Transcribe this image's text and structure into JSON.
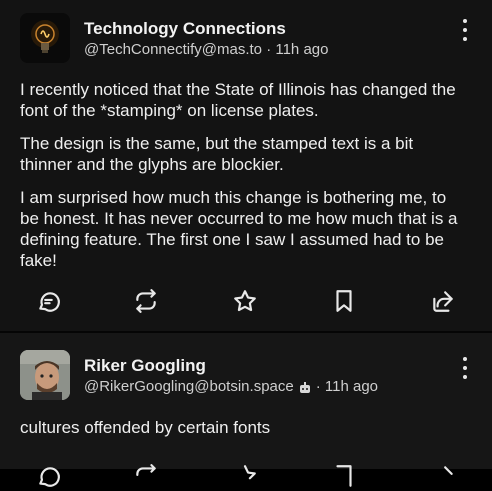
{
  "posts": [
    {
      "author": "Technology Connections",
      "handle": "@TechConnectify@mas.to",
      "time": "· 11h ago",
      "paragraphs": [
        "I recently noticed that the State of Illinois has changed the font of the *stamping* on license plates.",
        "The design is the same, but the stamped text is a bit thinner and the glyphs are blockier.",
        "I am surprised how much this change is bothering me, to be honest. It has never occurred to me how much that is a defining feature. The first one I saw I assumed had to be fake!"
      ]
    },
    {
      "author": "Riker Googling",
      "handle": "@RikerGoogling@botsin.space",
      "time": "· 11h ago",
      "paragraphs": [
        "cultures offended by certain fonts"
      ]
    }
  ],
  "actions": {
    "reply": "reply-icon",
    "boost": "repeat-icon",
    "favourite": "star-icon",
    "bookmark": "bookmark-icon",
    "share": "share-icon"
  },
  "colors": {
    "background": "#000000",
    "card": "#131313",
    "text": "#efefef",
    "secondary": "#cfcfcf"
  }
}
